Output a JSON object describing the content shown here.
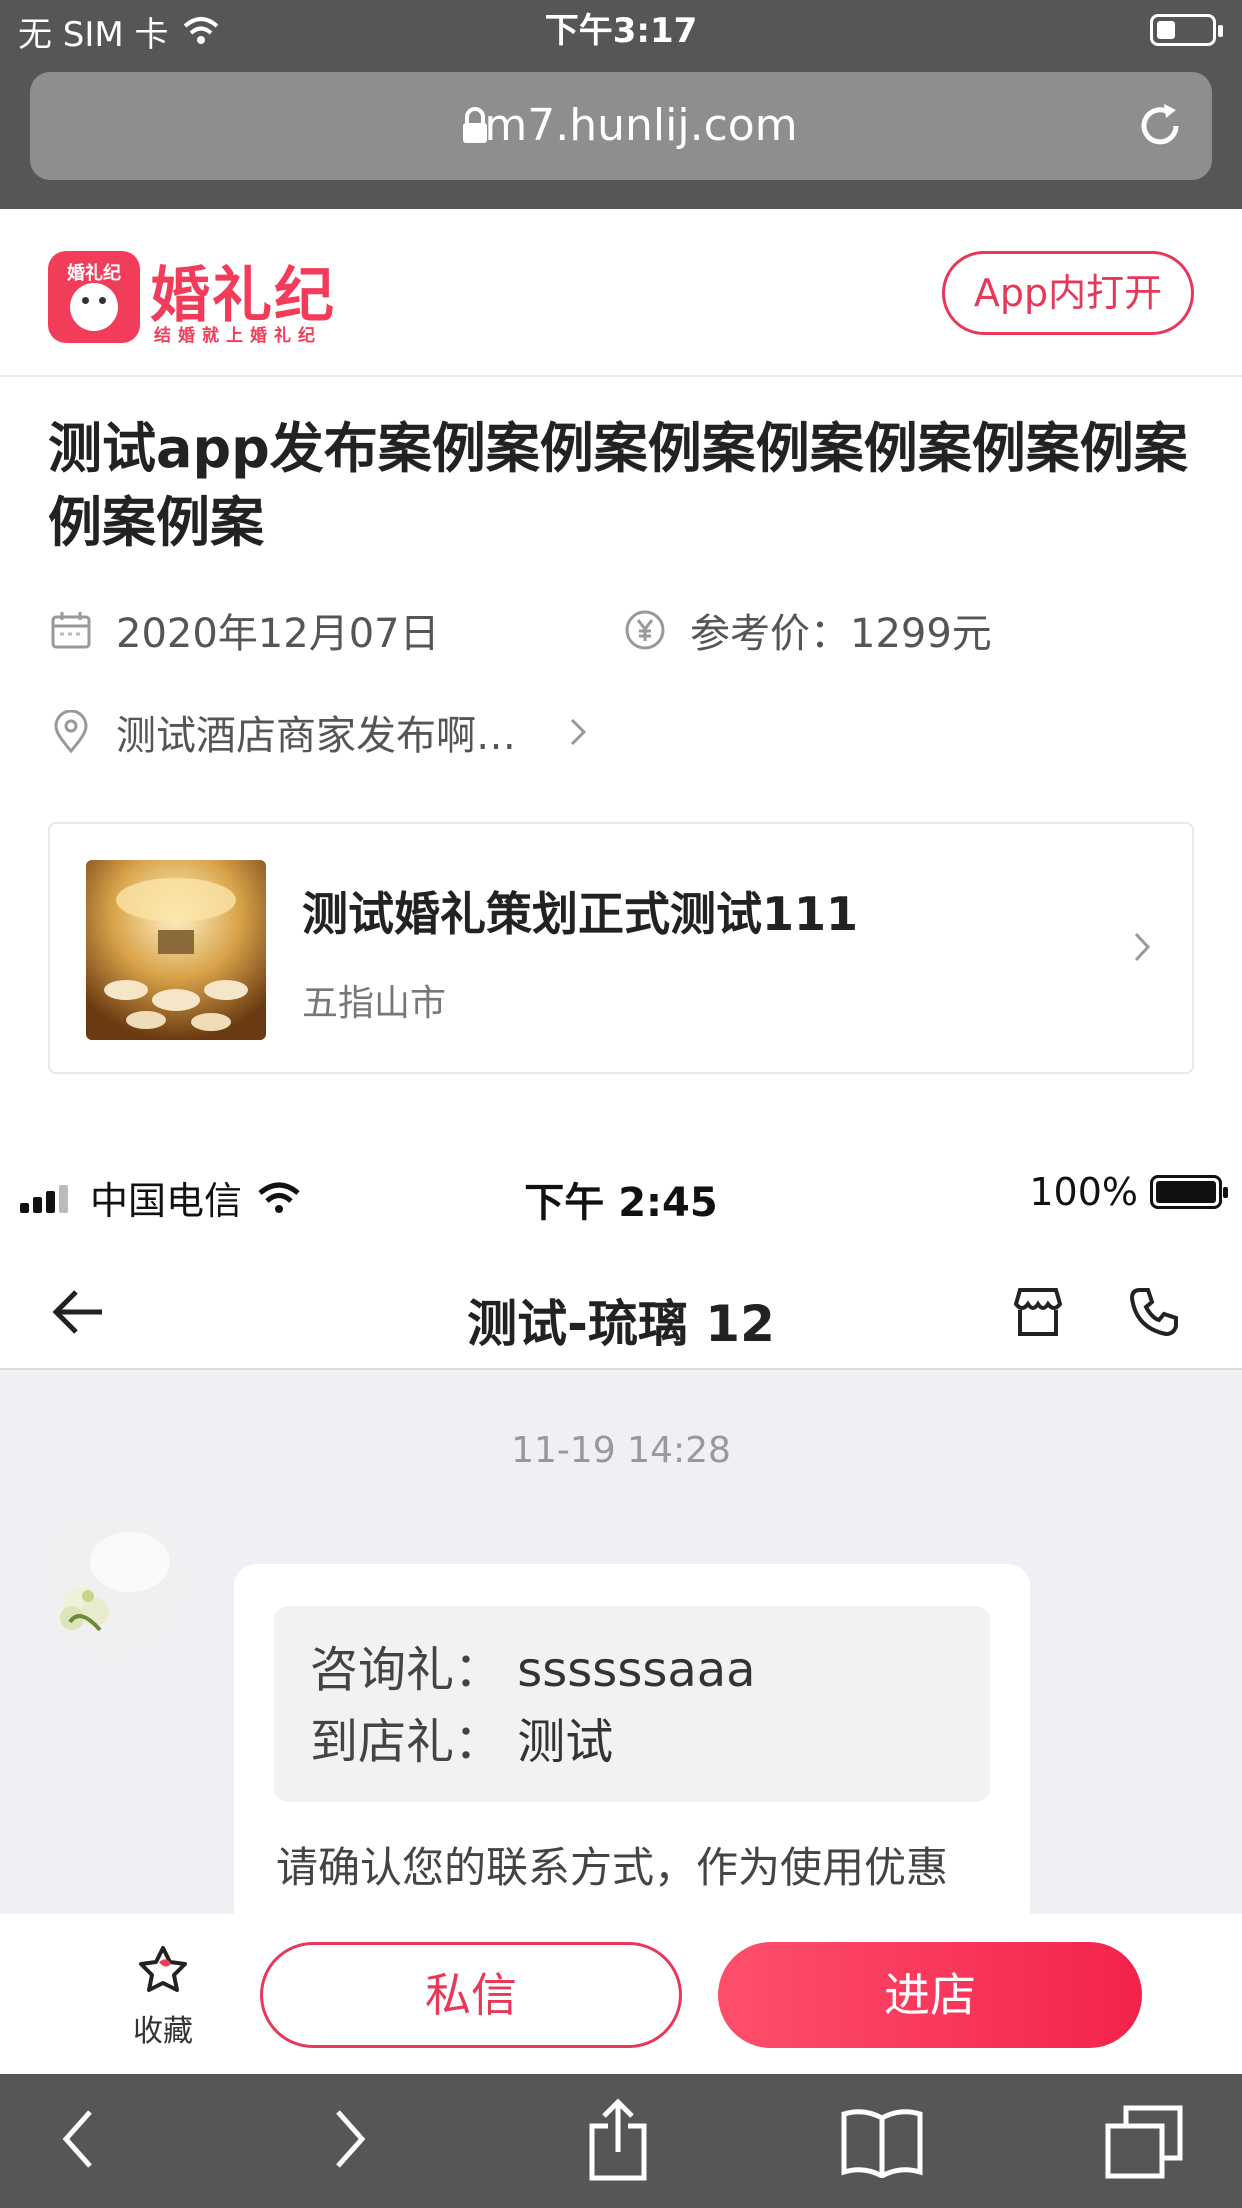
{
  "safari": {
    "status_left": "无 SIM 卡",
    "status_time": "下午3:17",
    "url": "m7.hunlij.com",
    "toolbar_icons": [
      "back-icon",
      "forward-icon",
      "share-icon",
      "bookmarks-icon",
      "tabs-icon"
    ]
  },
  "header": {
    "logo_mini": "婚礼纪",
    "brand": "婚礼纪",
    "slogan": "结婚就上婚礼纪",
    "open_app_label": "App内打开",
    "accent_color": "#e8385a"
  },
  "case": {
    "title": "测试app发布案例案例案例案例案例案例案例案例案例案",
    "date": "2020年12月07日",
    "price": "参考价：1299元",
    "location": "测试酒店商家发布啊…"
  },
  "merchant": {
    "name": "测试婚礼策划正式测试111",
    "city": "五指山市"
  },
  "chat": {
    "carrier": "中国电信",
    "time": "下午 2:45",
    "battery": "100%",
    "title": "测试-琉璃 12",
    "timestamp": "11-19 14:28",
    "gift_consult_label": "咨询礼：",
    "gift_consult_value": "ssssssaaa",
    "gift_visit_label": "到店礼：",
    "gift_visit_value": "测试",
    "message": "请确认您的联系方式，作为使用优惠"
  },
  "actions": {
    "favorite_label": "收藏",
    "message_label": "私信",
    "shop_label": "进店"
  }
}
